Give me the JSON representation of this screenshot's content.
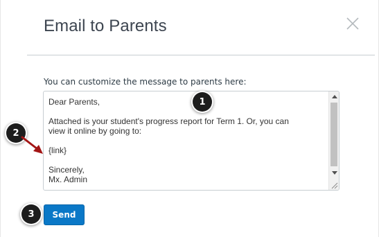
{
  "dialog": {
    "title": "Email to Parents",
    "prompt": "You can customize the message to parents here:",
    "message_lines": [
      "Dear Parents,",
      "",
      "Attached is your student's progress report for Term 1. Or, you can",
      "view it online by going to:",
      "",
      "{link}",
      "",
      "Sincerely,",
      "Mx. Admin"
    ],
    "send_label": "Send"
  },
  "callouts": [
    "1",
    "2",
    "3"
  ],
  "icons": {
    "close": "close-icon",
    "scroll_up": "scroll-up-arrow-icon",
    "scroll_down": "scroll-down-arrow-icon",
    "resize": "resize-grip-icon"
  },
  "colors": {
    "accent": "#0a78c7",
    "arrow": "#a31515",
    "callout": "#1d1d1d"
  }
}
